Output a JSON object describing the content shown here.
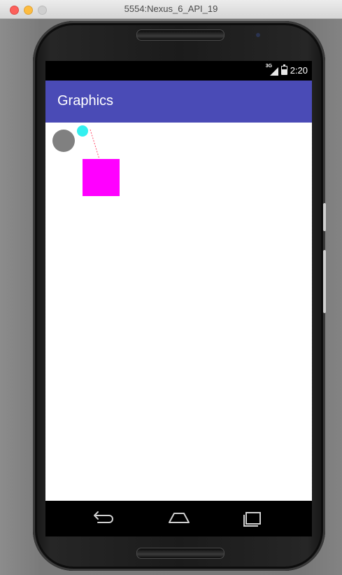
{
  "window": {
    "title": "5554:Nexus_6_API_19"
  },
  "status_bar": {
    "network": "3G",
    "time": "2:20"
  },
  "app_bar": {
    "title": "Graphics"
  },
  "canvas": {
    "shapes": [
      {
        "kind": "circle",
        "color": "#808080"
      },
      {
        "kind": "circle",
        "color": "#33f0f0"
      },
      {
        "kind": "dotted-line",
        "color": "#ff4d6d"
      },
      {
        "kind": "square",
        "color": "#ff00ff"
      }
    ]
  },
  "nav_bar": {
    "icons": [
      "back-icon",
      "home-icon",
      "recent-apps-icon"
    ]
  },
  "colors": {
    "app_bar": "#4a4bb6",
    "magenta": "#ff00ff",
    "cyan": "#33f0f0",
    "gray": "#808080"
  }
}
